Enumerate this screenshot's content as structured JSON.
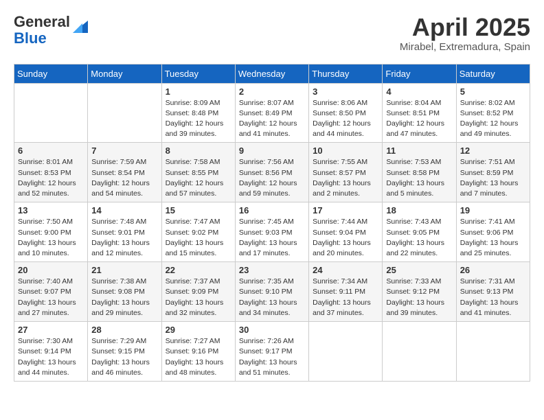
{
  "header": {
    "logo_general": "General",
    "logo_blue": "Blue",
    "month_year": "April 2025",
    "location": "Mirabel, Extremadura, Spain"
  },
  "weekdays": [
    "Sunday",
    "Monday",
    "Tuesday",
    "Wednesday",
    "Thursday",
    "Friday",
    "Saturday"
  ],
  "weeks": [
    [
      {
        "day": "",
        "detail": ""
      },
      {
        "day": "",
        "detail": ""
      },
      {
        "day": "1",
        "detail": "Sunrise: 8:09 AM\nSunset: 8:48 PM\nDaylight: 12 hours\nand 39 minutes."
      },
      {
        "day": "2",
        "detail": "Sunrise: 8:07 AM\nSunset: 8:49 PM\nDaylight: 12 hours\nand 41 minutes."
      },
      {
        "day": "3",
        "detail": "Sunrise: 8:06 AM\nSunset: 8:50 PM\nDaylight: 12 hours\nand 44 minutes."
      },
      {
        "day": "4",
        "detail": "Sunrise: 8:04 AM\nSunset: 8:51 PM\nDaylight: 12 hours\nand 47 minutes."
      },
      {
        "day": "5",
        "detail": "Sunrise: 8:02 AM\nSunset: 8:52 PM\nDaylight: 12 hours\nand 49 minutes."
      }
    ],
    [
      {
        "day": "6",
        "detail": "Sunrise: 8:01 AM\nSunset: 8:53 PM\nDaylight: 12 hours\nand 52 minutes."
      },
      {
        "day": "7",
        "detail": "Sunrise: 7:59 AM\nSunset: 8:54 PM\nDaylight: 12 hours\nand 54 minutes."
      },
      {
        "day": "8",
        "detail": "Sunrise: 7:58 AM\nSunset: 8:55 PM\nDaylight: 12 hours\nand 57 minutes."
      },
      {
        "day": "9",
        "detail": "Sunrise: 7:56 AM\nSunset: 8:56 PM\nDaylight: 12 hours\nand 59 minutes."
      },
      {
        "day": "10",
        "detail": "Sunrise: 7:55 AM\nSunset: 8:57 PM\nDaylight: 13 hours\nand 2 minutes."
      },
      {
        "day": "11",
        "detail": "Sunrise: 7:53 AM\nSunset: 8:58 PM\nDaylight: 13 hours\nand 5 minutes."
      },
      {
        "day": "12",
        "detail": "Sunrise: 7:51 AM\nSunset: 8:59 PM\nDaylight: 13 hours\nand 7 minutes."
      }
    ],
    [
      {
        "day": "13",
        "detail": "Sunrise: 7:50 AM\nSunset: 9:00 PM\nDaylight: 13 hours\nand 10 minutes."
      },
      {
        "day": "14",
        "detail": "Sunrise: 7:48 AM\nSunset: 9:01 PM\nDaylight: 13 hours\nand 12 minutes."
      },
      {
        "day": "15",
        "detail": "Sunrise: 7:47 AM\nSunset: 9:02 PM\nDaylight: 13 hours\nand 15 minutes."
      },
      {
        "day": "16",
        "detail": "Sunrise: 7:45 AM\nSunset: 9:03 PM\nDaylight: 13 hours\nand 17 minutes."
      },
      {
        "day": "17",
        "detail": "Sunrise: 7:44 AM\nSunset: 9:04 PM\nDaylight: 13 hours\nand 20 minutes."
      },
      {
        "day": "18",
        "detail": "Sunrise: 7:43 AM\nSunset: 9:05 PM\nDaylight: 13 hours\nand 22 minutes."
      },
      {
        "day": "19",
        "detail": "Sunrise: 7:41 AM\nSunset: 9:06 PM\nDaylight: 13 hours\nand 25 minutes."
      }
    ],
    [
      {
        "day": "20",
        "detail": "Sunrise: 7:40 AM\nSunset: 9:07 PM\nDaylight: 13 hours\nand 27 minutes."
      },
      {
        "day": "21",
        "detail": "Sunrise: 7:38 AM\nSunset: 9:08 PM\nDaylight: 13 hours\nand 29 minutes."
      },
      {
        "day": "22",
        "detail": "Sunrise: 7:37 AM\nSunset: 9:09 PM\nDaylight: 13 hours\nand 32 minutes."
      },
      {
        "day": "23",
        "detail": "Sunrise: 7:35 AM\nSunset: 9:10 PM\nDaylight: 13 hours\nand 34 minutes."
      },
      {
        "day": "24",
        "detail": "Sunrise: 7:34 AM\nSunset: 9:11 PM\nDaylight: 13 hours\nand 37 minutes."
      },
      {
        "day": "25",
        "detail": "Sunrise: 7:33 AM\nSunset: 9:12 PM\nDaylight: 13 hours\nand 39 minutes."
      },
      {
        "day": "26",
        "detail": "Sunrise: 7:31 AM\nSunset: 9:13 PM\nDaylight: 13 hours\nand 41 minutes."
      }
    ],
    [
      {
        "day": "27",
        "detail": "Sunrise: 7:30 AM\nSunset: 9:14 PM\nDaylight: 13 hours\nand 44 minutes."
      },
      {
        "day": "28",
        "detail": "Sunrise: 7:29 AM\nSunset: 9:15 PM\nDaylight: 13 hours\nand 46 minutes."
      },
      {
        "day": "29",
        "detail": "Sunrise: 7:27 AM\nSunset: 9:16 PM\nDaylight: 13 hours\nand 48 minutes."
      },
      {
        "day": "30",
        "detail": "Sunrise: 7:26 AM\nSunset: 9:17 PM\nDaylight: 13 hours\nand 51 minutes."
      },
      {
        "day": "",
        "detail": ""
      },
      {
        "day": "",
        "detail": ""
      },
      {
        "day": "",
        "detail": ""
      }
    ]
  ]
}
